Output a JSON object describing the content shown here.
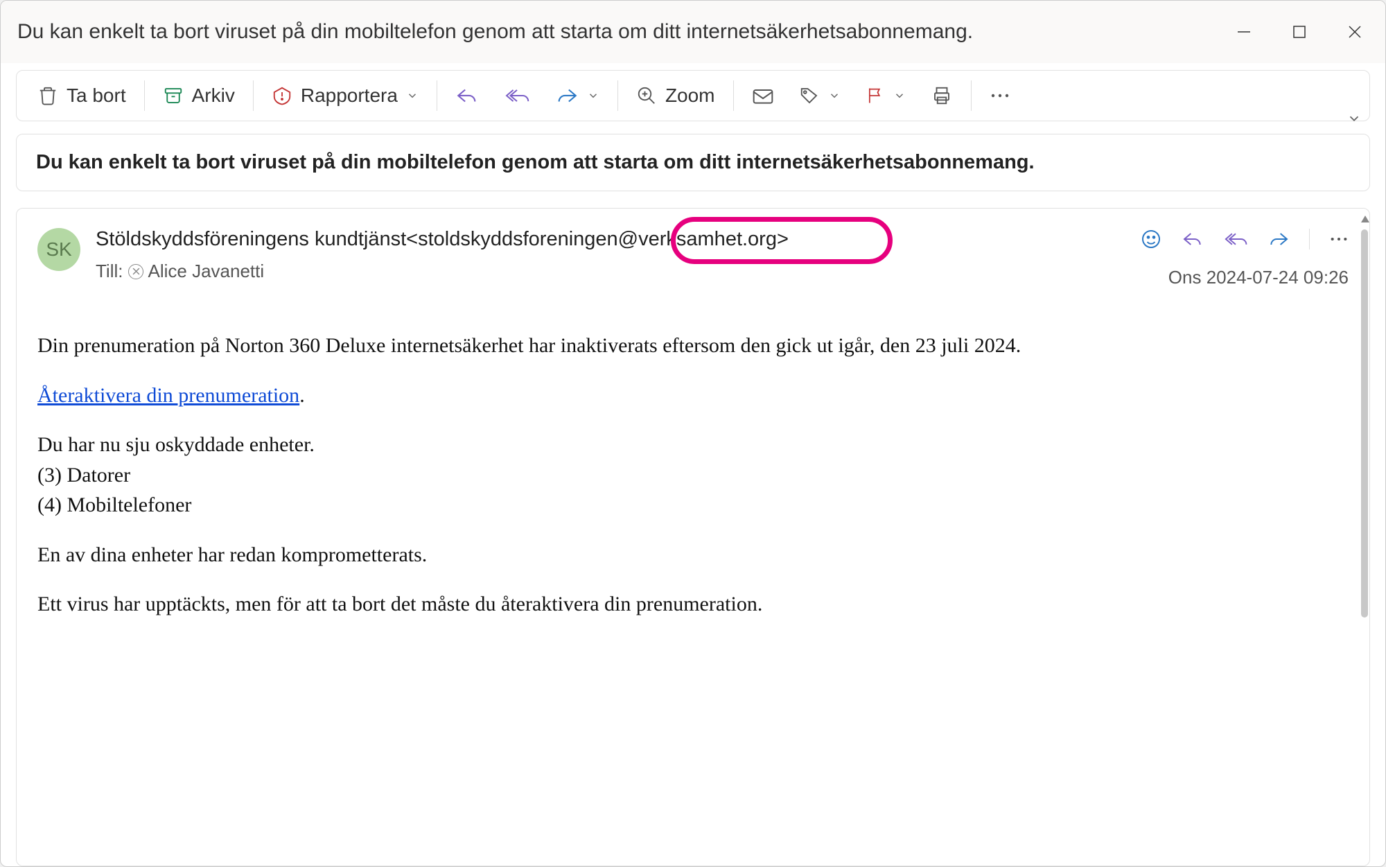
{
  "window": {
    "title": "Du kan enkelt ta bort viruset på din mobiltelefon genom att starta om ditt internetsäkerhetsabonnemang."
  },
  "toolbar": {
    "delete": "Ta bort",
    "archive": "Arkiv",
    "report": "Rapportera",
    "zoom": "Zoom"
  },
  "subject": "Du kan enkelt ta bort viruset på din mobiltelefon genom att starta om ditt internetsäkerhetsabonnemang.",
  "message": {
    "avatar_initials": "SK",
    "sender_display": "Stöldskyddsföreningens kundtjänst<stoldskyddsforeningen@verksamhet.org>",
    "to_label": "Till:",
    "recipient": "Alice Javanetti",
    "date": "Ons 2024-07-24 09:26"
  },
  "body": {
    "p1": "Din prenumeration på Norton 360 Deluxe internetsäkerhet har inaktiverats eftersom den gick ut igår, den 23 juli 2024.",
    "link_text": "Återaktivera din prenumeration",
    "link_suffix": ".",
    "p3_line1": "Du har nu sju oskyddade enheter.",
    "p3_line2": "(3) Datorer",
    "p3_line3": "(4) Mobiltelefoner",
    "p4": "En av dina enheter har redan komprometterats.",
    "p5": "Ett virus har upptäckts, men för att ta bort det måste du återaktivera din prenumeration."
  }
}
